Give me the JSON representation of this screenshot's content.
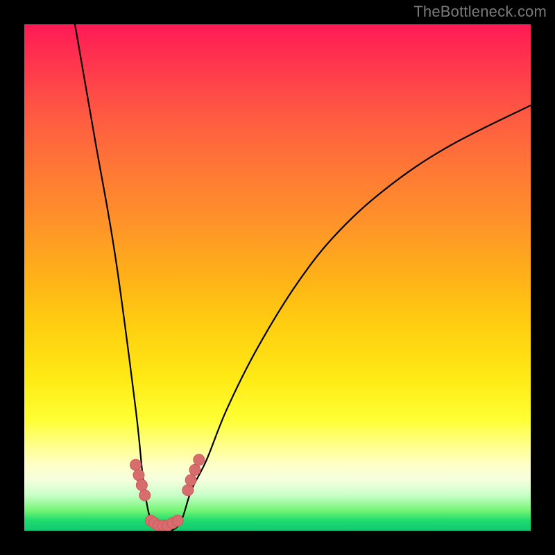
{
  "watermark": {
    "text": "TheBottleneck.com"
  },
  "colors": {
    "curve_stroke": "#000000",
    "marker_fill": "#d76d6d",
    "marker_stroke": "#c85a5a",
    "background": "#000000"
  },
  "chart_data": {
    "type": "line",
    "title": "",
    "xlabel": "",
    "ylabel": "",
    "xlim": [
      0,
      100
    ],
    "ylim": [
      0,
      100
    ],
    "grid": false,
    "legend": false,
    "series": [
      {
        "name": "bottleneck-curve",
        "description": "V-shaped curve; y interpreted from top of gradient=100 to bottom=0",
        "x": [
          10,
          14,
          18,
          22,
          23.5,
          25,
          27,
          29,
          31,
          33,
          36,
          40,
          46,
          54,
          62,
          72,
          84,
          100
        ],
        "y": [
          100,
          77,
          54,
          24,
          10,
          2,
          0,
          0,
          2,
          8,
          14,
          24,
          36,
          49,
          59,
          68,
          76,
          84
        ]
      },
      {
        "name": "markers-left-branch",
        "description": "Highlighted scatter points on lower left branch",
        "x": [
          22.0,
          22.6,
          23.2,
          23.8
        ],
        "y": [
          13,
          11,
          9,
          7
        ]
      },
      {
        "name": "markers-bottom",
        "description": "Highlighted scatter points cluster at the valley floor",
        "x": [
          25.0,
          25.7,
          26.5,
          27.4,
          28.3,
          29.3,
          30.3
        ],
        "y": [
          2,
          1.5,
          1,
          1,
          1,
          1.5,
          2
        ]
      },
      {
        "name": "markers-right-branch",
        "description": "Highlighted scatter points on lower right branch",
        "x": [
          32.3,
          32.9,
          33.7,
          34.5
        ],
        "y": [
          8,
          10,
          12,
          14
        ]
      }
    ]
  }
}
